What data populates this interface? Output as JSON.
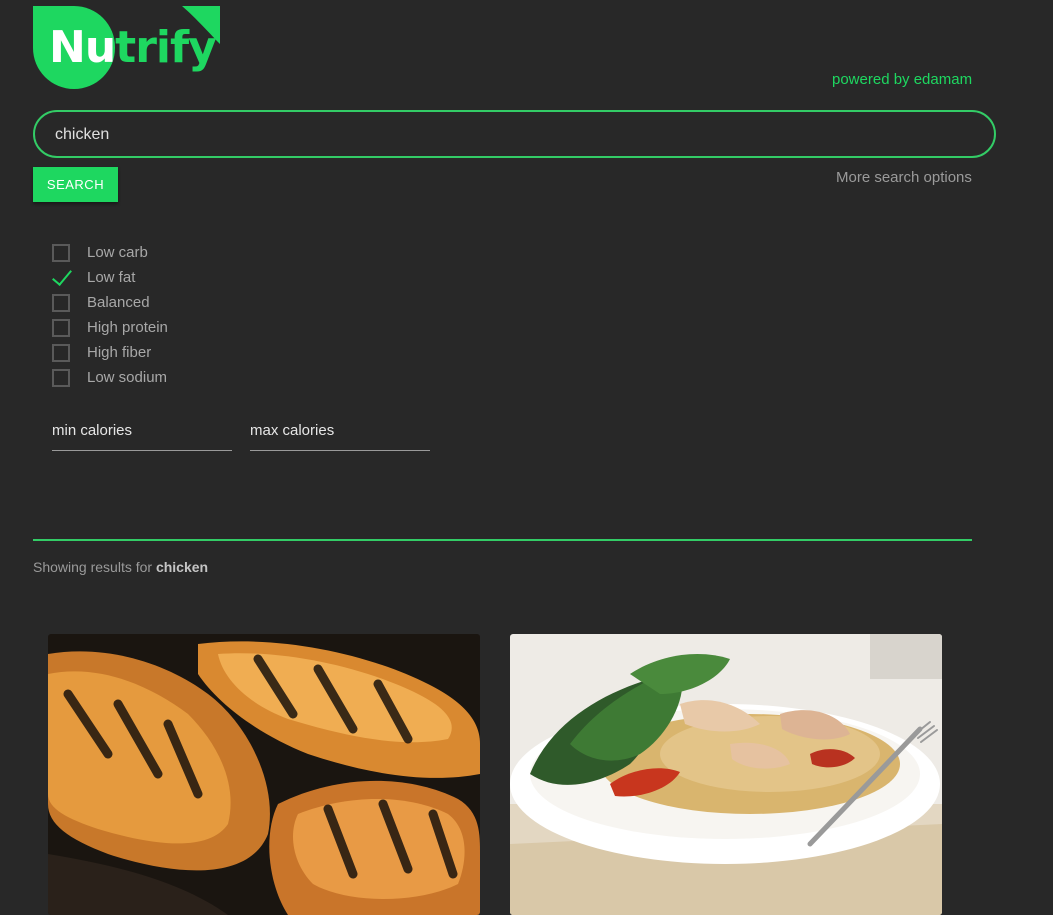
{
  "brand": {
    "logo_part_a": "Nu",
    "logo_part_b": "trify",
    "powered_by": "powered by edamam",
    "accent_color": "#1ed760"
  },
  "search": {
    "value": "chicken",
    "button_label": "SEARCH",
    "more_options_label": "More search options"
  },
  "filters": [
    {
      "label": "Low carb",
      "checked": false
    },
    {
      "label": "Low fat",
      "checked": true
    },
    {
      "label": "Balanced",
      "checked": false
    },
    {
      "label": "High protein",
      "checked": false
    },
    {
      "label": "High fiber",
      "checked": false
    },
    {
      "label": "Low sodium",
      "checked": false
    }
  ],
  "calories": {
    "min_placeholder": "min calories",
    "max_placeholder": "max calories"
  },
  "results": {
    "prefix": "Showing results for",
    "query": "chicken"
  },
  "recipes": [
    {
      "image": "grilled-chicken-photo"
    },
    {
      "image": "couscous-salad-photo"
    }
  ]
}
